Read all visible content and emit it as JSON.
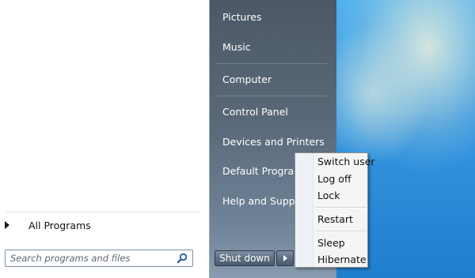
{
  "start_menu": {
    "left_pane": {
      "all_programs_label": "All Programs",
      "search_placeholder": "Search programs and files"
    },
    "right_pane": {
      "items": [
        {
          "label": "Pictures"
        },
        {
          "label": "Music"
        },
        {
          "label": "Computer"
        },
        {
          "label": "Control Panel"
        },
        {
          "label": "Devices and Printers"
        },
        {
          "label": "Default Programs"
        },
        {
          "label": "Help and Support"
        }
      ],
      "shutdown_label": "Shut down"
    },
    "power_menu": {
      "items": [
        {
          "label": "Switch user"
        },
        {
          "label": "Log off"
        },
        {
          "label": "Lock"
        },
        {
          "label": "Restart"
        },
        {
          "label": "Sleep"
        },
        {
          "label": "Hibernate"
        }
      ]
    }
  }
}
